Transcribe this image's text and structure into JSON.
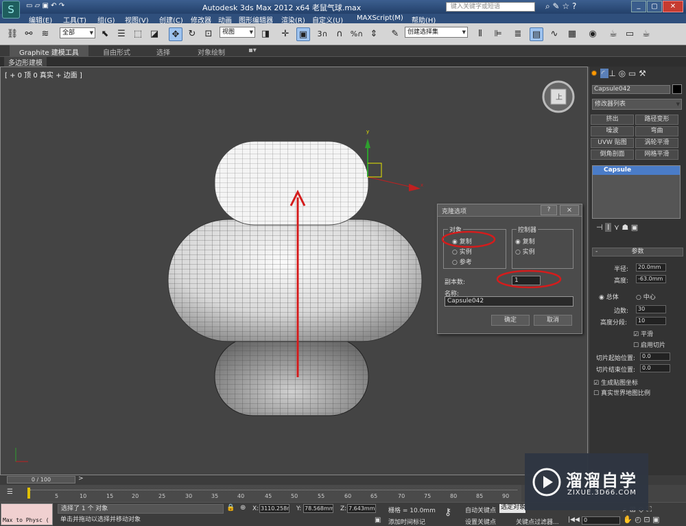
{
  "app": {
    "title": "Autodesk 3ds Max  2012 x64   老鼠气球.max",
    "search_placeholder": "键入关键字或短语"
  },
  "menu": [
    "编辑(E)",
    "工具(T)",
    "组(G)",
    "视图(V)",
    "创建(C)",
    "修改器",
    "动画",
    "图形编辑器",
    "渲染(R)",
    "自定义(U)",
    "MAXScript(M)",
    "帮助(H)"
  ],
  "toolbar": {
    "selection_filter": "全部",
    "ref_coord": "视图",
    "named_selection": "创建选择集"
  },
  "ribbon": {
    "tabs": [
      "Graphite 建模工具",
      "自由形式",
      "选择",
      "对象绘制"
    ],
    "sub": "多边形建模"
  },
  "viewport": {
    "label": "[ + 0 顶 0 真实 + 边面 ]"
  },
  "dialog": {
    "title": "克隆选项",
    "help": "?",
    "close": "×",
    "object_group": "对象",
    "object_options": [
      "复制",
      "实例",
      "参考"
    ],
    "controller_group": "控制器",
    "controller_options": [
      "复制",
      "实例"
    ],
    "copies_label": "副本数:",
    "copies_value": "1",
    "name_label": "名称:",
    "name_value": "Capsule042",
    "ok": "确定",
    "cancel": "取消"
  },
  "command_panel": {
    "object_name": "Capsule042",
    "modifier_list": "修改器列表",
    "modifier_buttons": [
      "挤出",
      "路径变形",
      "噪波",
      "弯曲",
      "UVW 贴图",
      "涡轮平滑",
      "倒角剖面",
      "网格平滑"
    ],
    "stack_item": "Capsule",
    "params_title": "参数",
    "radius_label": "半径:",
    "radius_value": "20.0mm",
    "height_label": "高度:",
    "height_value": "-63.0mm",
    "overall": "总体",
    "centers": "中心",
    "sides_label": "边数:",
    "sides_value": "30",
    "height_segs_label": "高度分段:",
    "height_segs_value": "10",
    "smooth": "平滑",
    "slice_on": "启用切片",
    "slice_from_label": "切片起始位置:",
    "slice_from_value": "0.0",
    "slice_to_label": "切片结束位置:",
    "slice_to_value": "0.0",
    "gen_map": "生成贴图坐标",
    "real_world": "真实世界地图比例"
  },
  "timeline": {
    "frame": "0 / 100",
    "ticks": [
      "5",
      "10",
      "15",
      "20",
      "25",
      "30",
      "35",
      "40",
      "45",
      "50",
      "55",
      "60",
      "65",
      "70",
      "75",
      "80",
      "85",
      "90"
    ]
  },
  "status": {
    "maxscript": "Max to Physc (",
    "selected": "选择了 1 个 对象",
    "prompt": "单击并拖动以选择并移动对象",
    "x_label": "X:",
    "x_value": "3110.258n",
    "y_label": "Y:",
    "y_value": "78.568mm",
    "z_label": "Z:",
    "z_value": "7.643mm",
    "grid": "栅格 = 10.0mm",
    "add_time_tag": "添加时间标记",
    "auto_key": "自动关键点",
    "set_key": "设置关键点",
    "selected_obj": "选定对象",
    "key_filters": "关键点过滤器...",
    "frame_value": "0"
  },
  "watermark": {
    "name": "溜溜自学",
    "url": "ZIXUE.3D66.COM"
  },
  "colors": {
    "accent_red": "#d41c1c",
    "title_blue": "#2f4f7c"
  }
}
